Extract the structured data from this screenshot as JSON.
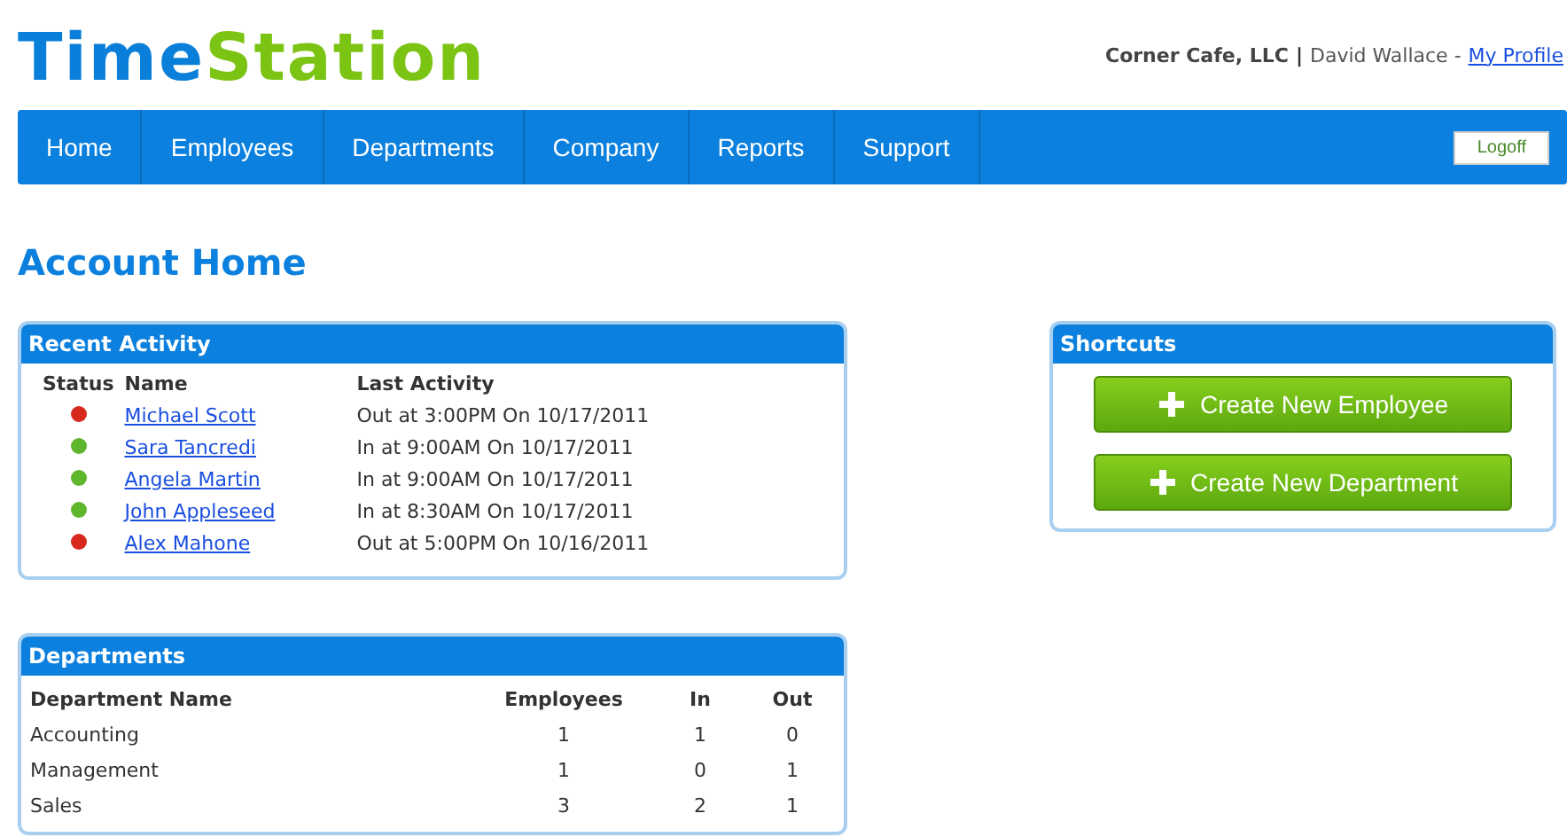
{
  "logo": [
    {
      "text": "Time",
      "kind": "primary"
    },
    {
      "text": "Station",
      "kind": "accent"
    }
  ],
  "account": {
    "company": "Corner Cafe, LLC",
    "separator": "|",
    "user": "David Wallace -",
    "profile_link": "My Profile"
  },
  "nav": {
    "items": [
      {
        "label": "Home"
      },
      {
        "label": "Employees"
      },
      {
        "label": "Departments"
      },
      {
        "label": "Company"
      },
      {
        "label": "Reports"
      },
      {
        "label": "Support"
      }
    ],
    "logoff": "Logoff"
  },
  "page_title": "Account Home",
  "recent_activity": {
    "title": "Recent Activity",
    "columns": [
      "Status",
      "Name",
      "Last Activity"
    ],
    "rows": [
      {
        "color": "#d8281e",
        "name": "Michael Scott",
        "activity": "Out at 3:00PM On 10/17/2011"
      },
      {
        "color": "#5fb52c",
        "name": "Sara Tancredi",
        "activity": "In at 9:00AM On 10/17/2011"
      },
      {
        "color": "#5fb52c",
        "name": "Angela Martin",
        "activity": "In at 9:00AM On 10/17/2011"
      },
      {
        "color": "#5fb52c",
        "name": "John Appleseed",
        "activity": "In at 8:30AM On 10/17/2011"
      },
      {
        "color": "#d8281e",
        "name": "Alex Mahone",
        "activity": "Out at 5:00PM On 10/16/2011"
      }
    ]
  },
  "shortcuts": {
    "title": "Shortcuts",
    "buttons": [
      "Create New Employee",
      "Create New Department"
    ]
  },
  "departments": {
    "title": "Departments",
    "columns": [
      "Department Name",
      "Employees",
      "In",
      "Out"
    ],
    "rows": [
      [
        "Accounting",
        "1",
        "1",
        "0"
      ],
      [
        "Management",
        "1",
        "0",
        "1"
      ],
      [
        "Sales",
        "3",
        "2",
        "1"
      ]
    ]
  }
}
